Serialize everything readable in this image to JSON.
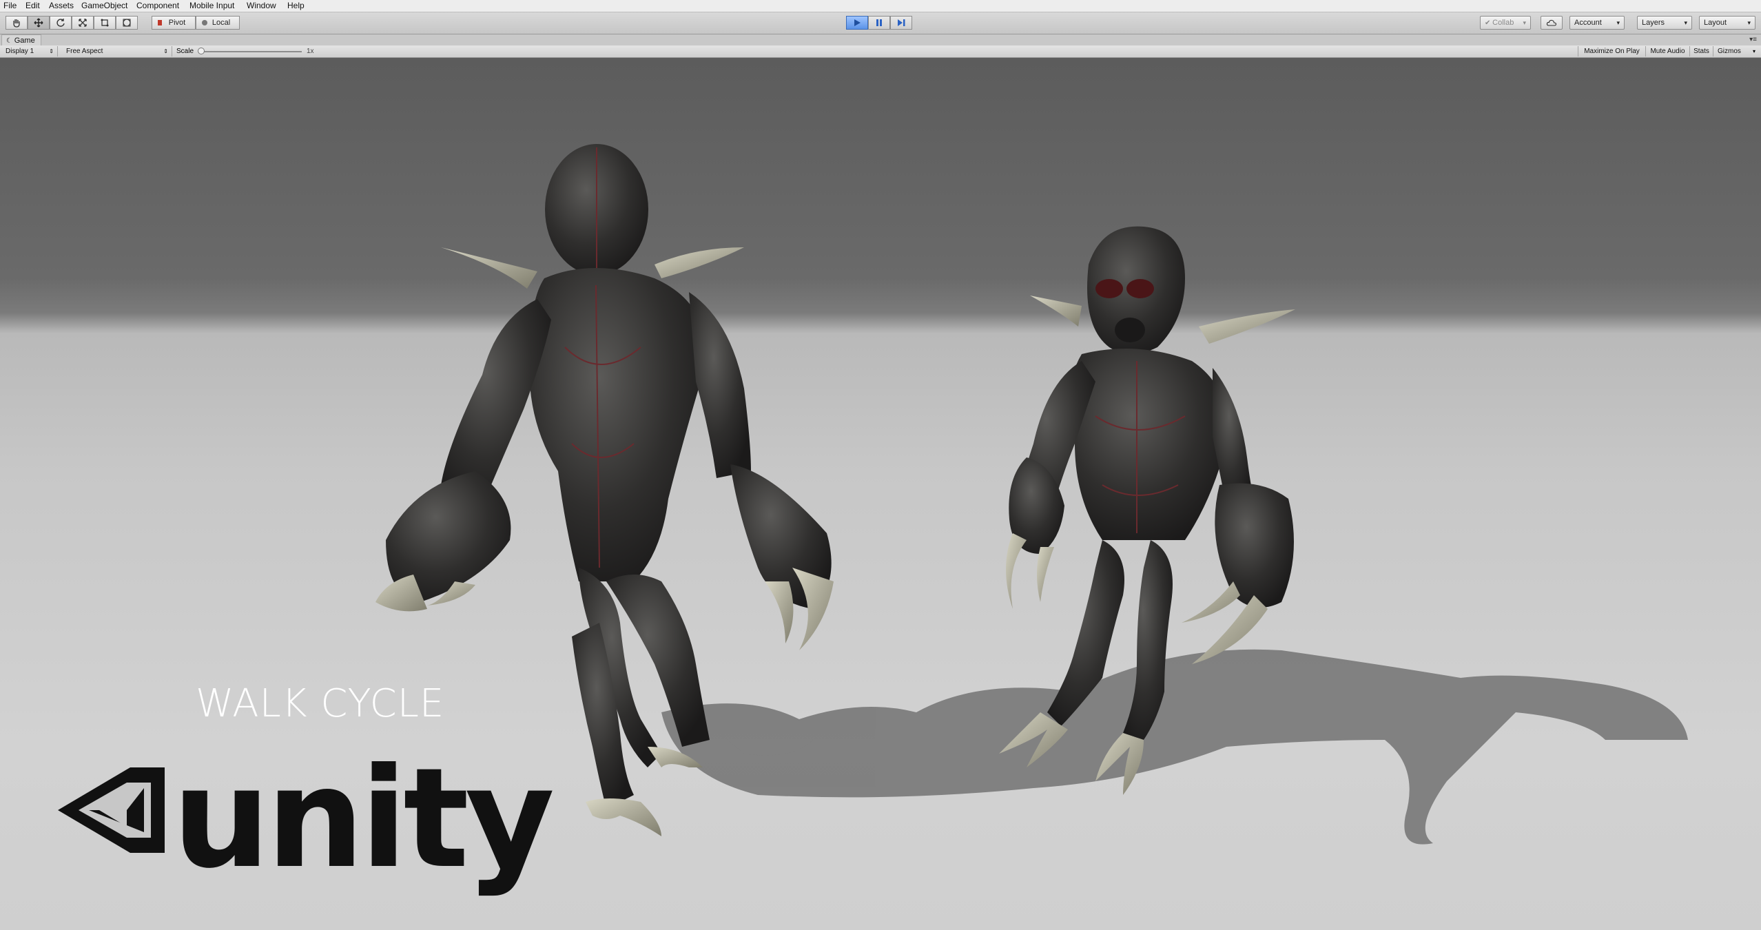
{
  "menu": [
    "File",
    "Edit",
    "Assets",
    "GameObject",
    "Component",
    "Mobile Input",
    "Window",
    "Help"
  ],
  "toolbar": {
    "pivot_label": "Pivot",
    "local_label": "Local",
    "collab_label": "Collab",
    "account_label": "Account",
    "layers_label": "Layers",
    "layout_label": "Layout",
    "play_color": "#5b93e8"
  },
  "game_tab": {
    "title": "Game",
    "display": "Display 1",
    "aspect": "Free Aspect",
    "scale_label": "Scale",
    "scale_value": "1x",
    "maximize": "Maximize On Play",
    "mute": "Mute Audio",
    "stats": "Stats",
    "gizmos": "Gizmos"
  },
  "scene": {
    "caption": "WALK CYCLE",
    "logo_text": "unity"
  }
}
